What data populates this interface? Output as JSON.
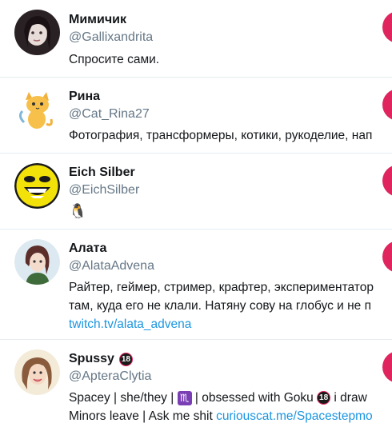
{
  "users": [
    {
      "name": "Мимичик",
      "handle": "@Gallixandrita",
      "bio_lines": [
        "Спросите сами."
      ]
    },
    {
      "name": "Рина",
      "handle": "@Cat_Rina27",
      "bio_lines": [
        "Фотография, трансформеры, котики, рукоделие, нап"
      ]
    },
    {
      "name": "Eich Silber",
      "handle": "@EichSilber",
      "bio_emoji": "🐧"
    },
    {
      "name": "Алата",
      "handle": "@AlataAdvena",
      "bio_lines": [
        "Райтер, геймер, стример, крафтер, экспериментатор",
        "там, куда его не клали. Натяну сову на глобус и не п"
      ],
      "bio_link": "twitch.tv/alata_advena"
    },
    {
      "name": "Spussy",
      "name_badge": "18",
      "handle": "@ApteraClytia",
      "bio_line1": {
        "a": "Spacey | she/they | ",
        "sign": "♏",
        "b": " | obsessed with Goku ",
        "badge": "18",
        "c": " i draw"
      },
      "bio_line2": {
        "text": "Minors leave | Ask me shit ",
        "link": "curiouscat.me/Spacestepmo"
      }
    }
  ],
  "colors": {
    "follow_button": "#e0245e",
    "handle": "#657786",
    "link": "#1b95e0",
    "divider": "#e6ecf0"
  },
  "icons": [
    "avatar-mimichik",
    "avatar-rina-cat",
    "avatar-smiley",
    "avatar-alata",
    "avatar-spussy",
    "penguin-emoji",
    "scorpio-sign-icon",
    "adult-18-icon"
  ]
}
